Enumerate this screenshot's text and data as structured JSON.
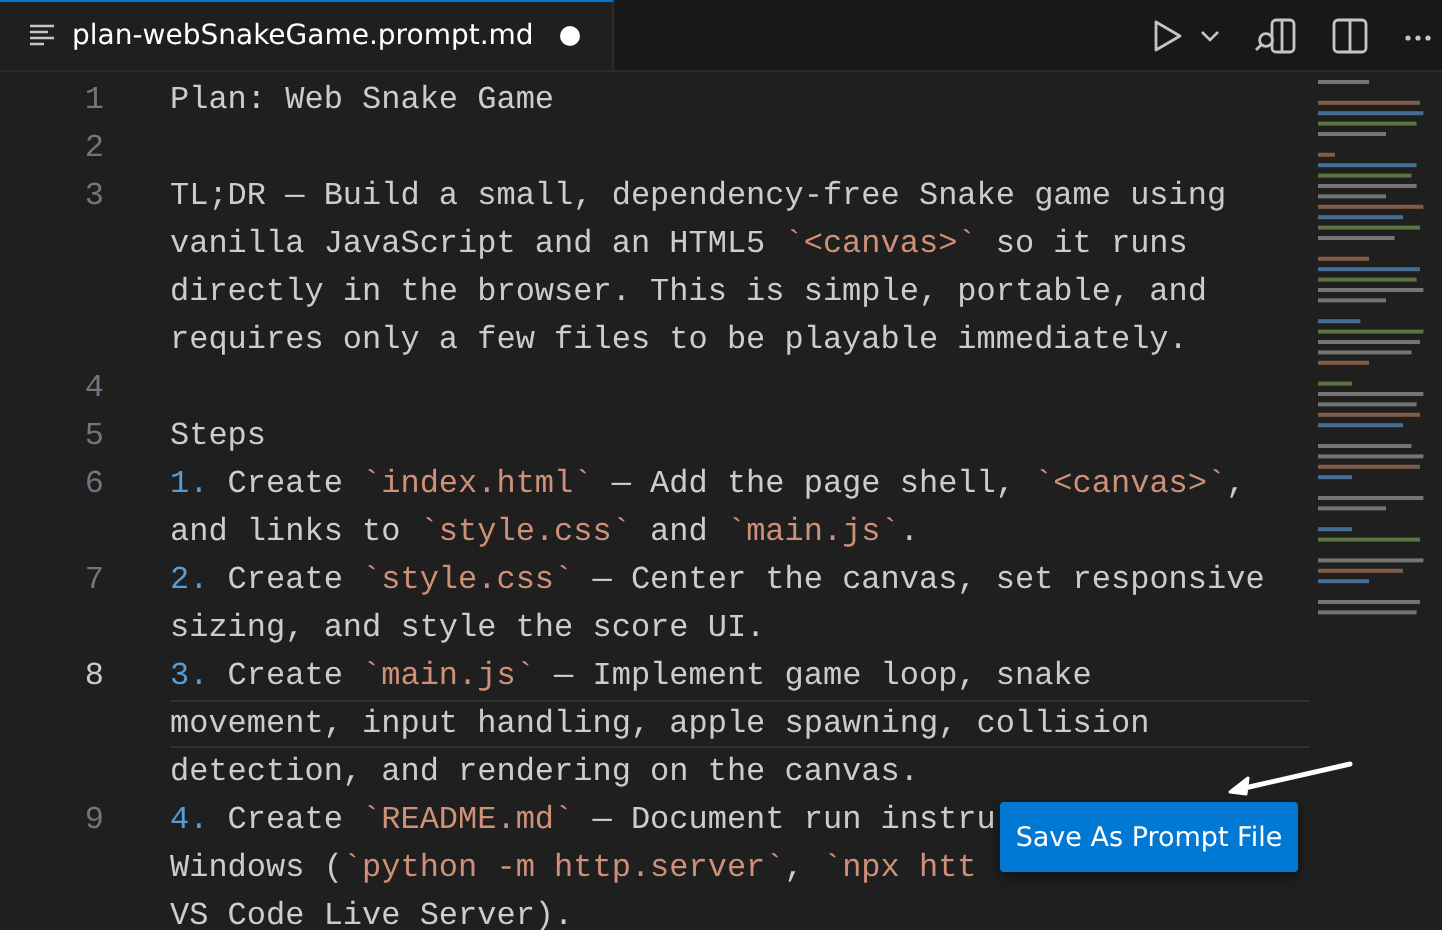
{
  "tab": {
    "title": "plan-webSnakeGame.prompt.md",
    "modified": true,
    "selected": true
  },
  "lines": [
    {
      "number": "1",
      "active": false,
      "rows": [
        {
          "highlighted": false,
          "segments": [
            {
              "kind": "text",
              "text": "Plan: Web Snake Game"
            }
          ]
        }
      ]
    },
    {
      "number": "2",
      "active": false,
      "rows": [
        {
          "highlighted": false
        }
      ]
    },
    {
      "number": "3",
      "active": false,
      "rows": [
        {
          "highlighted": false,
          "segments": [
            {
              "kind": "text",
              "text": "TL;DR — Build a small, dependency-free Snake game using"
            }
          ]
        },
        {
          "highlighted": false,
          "segments": [
            {
              "kind": "text",
              "text": "vanilla JavaScript and an HTML5 "
            },
            {
              "kind": "code",
              "text": "`<canvas>`"
            },
            {
              "kind": "text",
              "text": " so it runs"
            }
          ]
        },
        {
          "highlighted": false,
          "segments": [
            {
              "kind": "text",
              "text": "directly in the browser. This is simple, portable, and"
            }
          ]
        },
        {
          "highlighted": false,
          "segments": [
            {
              "kind": "text",
              "text": "requires only a few files to be playable immediately."
            }
          ]
        }
      ]
    },
    {
      "number": "4",
      "active": false,
      "rows": [
        {
          "highlighted": false
        }
      ]
    },
    {
      "number": "5",
      "active": false,
      "rows": [
        {
          "highlighted": false,
          "segments": [
            {
              "kind": "text",
              "text": "Steps"
            }
          ]
        }
      ]
    },
    {
      "number": "6",
      "active": false,
      "rows": [
        {
          "highlighted": false,
          "segments": [
            {
              "kind": "list",
              "text": "1."
            },
            {
              "kind": "text",
              "text": " Create "
            },
            {
              "kind": "code",
              "text": "`index.html`"
            },
            {
              "kind": "text",
              "text": " — Add the page shell, "
            },
            {
              "kind": "code",
              "text": "`<canvas>`"
            },
            {
              "kind": "text",
              "text": ","
            }
          ]
        },
        {
          "highlighted": false,
          "segments": [
            {
              "kind": "text",
              "text": "and links to "
            },
            {
              "kind": "code",
              "text": "`style.css`"
            },
            {
              "kind": "text",
              "text": " and "
            },
            {
              "kind": "code",
              "text": "`main.js`"
            },
            {
              "kind": "text",
              "text": "."
            }
          ]
        }
      ]
    },
    {
      "number": "7",
      "active": false,
      "rows": [
        {
          "highlighted": false,
          "segments": [
            {
              "kind": "list",
              "text": "2."
            },
            {
              "kind": "text",
              "text": " Create "
            },
            {
              "kind": "code",
              "text": "`style.css`"
            },
            {
              "kind": "text",
              "text": " — Center the canvas, set responsive"
            }
          ]
        },
        {
          "highlighted": false,
          "segments": [
            {
              "kind": "text",
              "text": "sizing, and style the score UI."
            }
          ]
        }
      ]
    },
    {
      "number": "8",
      "active": true,
      "rows": [
        {
          "highlighted": false,
          "segments": [
            {
              "kind": "list",
              "text": "3."
            },
            {
              "kind": "text",
              "text": " Create "
            },
            {
              "kind": "code",
              "text": "`main.js`"
            },
            {
              "kind": "text",
              "text": " — Implement game loop, snake"
            }
          ]
        },
        {
          "highlighted": true,
          "segments": [
            {
              "kind": "text",
              "text": "movement, input handling, apple spawning, collision"
            }
          ]
        },
        {
          "highlighted": false,
          "segments": [
            {
              "kind": "text",
              "text": "detection, and rendering on the canvas."
            }
          ]
        }
      ]
    },
    {
      "number": "9",
      "active": false,
      "rows": [
        {
          "highlighted": false,
          "segments": [
            {
              "kind": "list",
              "text": "4."
            },
            {
              "kind": "text",
              "text": " Create "
            },
            {
              "kind": "code",
              "text": "`README.md`"
            },
            {
              "kind": "text",
              "text": " — Document run instru"
            }
          ]
        },
        {
          "highlighted": false,
          "segments": [
            {
              "kind": "text",
              "text": "Windows ("
            },
            {
              "kind": "code",
              "text": "`python -m http.server`"
            },
            {
              "kind": "text",
              "text": ", "
            },
            {
              "kind": "code",
              "text": "`npx htt"
            }
          ]
        },
        {
          "highlighted": false,
          "segments": [
            {
              "kind": "text",
              "text": "VS Code Live Server)."
            }
          ]
        }
      ]
    }
  ],
  "popup_button": {
    "label": "Save As Prompt File"
  }
}
